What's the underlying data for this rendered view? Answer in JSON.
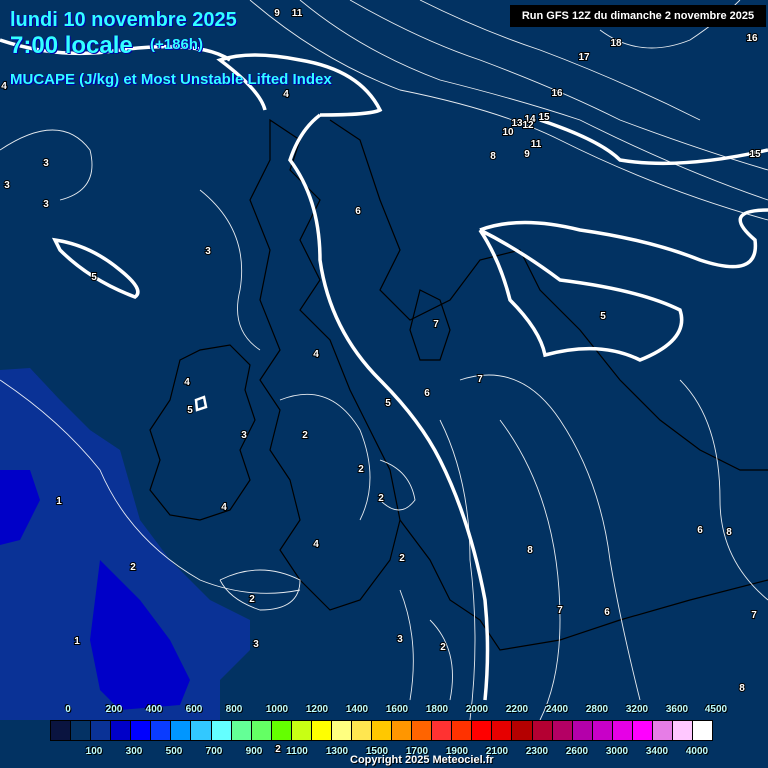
{
  "header": {
    "date": "lundi 10 novembre 2025",
    "time": "7:00 locale",
    "lead": "(+186h)",
    "parameter": "MUCAPE (J/kg) et Most Unstable Lifted Index",
    "run": "Run GFS 12Z du dimanche 2 novembre 2025"
  },
  "colorbar": {
    "colors": [
      "#0a1440",
      "#043264",
      "#0a3296",
      "#0000c8",
      "#0000ff",
      "#0a3cff",
      "#0096ff",
      "#32c8ff",
      "#64ffff",
      "#64ff96",
      "#64ff64",
      "#64ff00",
      "#c8ff14",
      "#ffff00",
      "#ffff80",
      "#ffe650",
      "#ffc800",
      "#ff9600",
      "#ff6400",
      "#ff3232",
      "#ff3200",
      "#ff0000",
      "#e60000",
      "#b40000",
      "#b40032",
      "#b40064",
      "#b400aa",
      "#c800c8",
      "#e600e6",
      "#ff00ff",
      "#e67de6",
      "#ffc8ff",
      "#ffffff"
    ],
    "top_labels": [
      "0",
      "200",
      "400",
      "600",
      "800",
      "1000",
      "1200",
      "1400",
      "1600",
      "1800",
      "2000",
      "2200",
      "2400",
      "2800",
      "3200",
      "3600",
      "4500"
    ],
    "bottom_labels": [
      "100",
      "300",
      "500",
      "700",
      "900",
      "1100",
      "1300",
      "1500",
      "1700",
      "1900",
      "2100",
      "2300",
      "2600",
      "3000",
      "3400",
      "4000"
    ]
  },
  "contour_labels": [
    "9",
    "11",
    "18",
    "17",
    "16",
    "16",
    "15",
    "4",
    "4",
    "3",
    "3",
    "3",
    "3",
    "5",
    "6",
    "8",
    "13",
    "14",
    "15",
    "10",
    "12",
    "11",
    "9",
    "7",
    "5",
    "7",
    "4",
    "4",
    "5",
    "6",
    "3",
    "2",
    "5",
    "2",
    "2",
    "4",
    "2",
    "1",
    "2",
    "4",
    "2",
    "8",
    "6",
    "7",
    "6",
    "8",
    "7",
    "8",
    "2",
    "3",
    "3",
    "2",
    "1"
  ],
  "copyright": "Copyright 2025 Meteociel.fr"
}
